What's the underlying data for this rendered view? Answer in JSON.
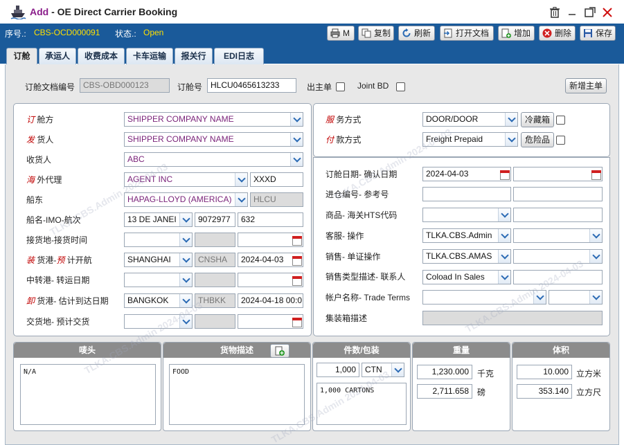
{
  "window": {
    "title_prefix": "Add",
    "title": " - OE Direct Carrier Booking"
  },
  "infobar": {
    "seq_label": "序号.:",
    "seq_value": "CBS-OCD000091",
    "status_label": "状态.:",
    "status_value": "Open"
  },
  "toolbar": {
    "m_label": "M",
    "copy_label": "复制",
    "refresh_label": "刷新",
    "open_doc_label": "打开文档",
    "add_label": "增加",
    "delete_label": "删除",
    "save_label": "保存"
  },
  "tabs": [
    {
      "label": "订舱"
    },
    {
      "label": "承运人"
    },
    {
      "label": "收费成本"
    },
    {
      "label": "卡车运输"
    },
    {
      "label": "报关行"
    },
    {
      "label": "EDI日志"
    }
  ],
  "top": {
    "doc_no_label": "订舱文档编号",
    "doc_no_value": "CBS-OBD000123",
    "booking_no_label": "订舱号",
    "booking_no_value": "HLCU0465613233",
    "master_bill_label": "出主单",
    "joint_bd_label": "Joint BD",
    "new_master_button": "新增主单"
  },
  "left": {
    "booker_label_red": "订",
    "booker_label": " 舱方",
    "booker_value": "SHIPPER COMPANY NAME",
    "shipper_label_red": "发",
    "shipper_label": " 货人",
    "shipper_value": "SHIPPER COMPANY NAME",
    "consignee_label": "收货人",
    "consignee_value": "ABC",
    "agent_label_red": "海",
    "agent_label": " 外代理",
    "agent_value": "AGENT INC",
    "agent_code": "XXXD",
    "carrier_label": "船东",
    "carrier_value": "HAPAG-LLOYD (AMERICA)",
    "carrier_code": "HLCU",
    "vessel_label": "船名-IMO-航次",
    "vessel_value": "13 DE JANEI",
    "imo_value": "9072977",
    "voyage_value": "632",
    "receipt_label": "接货地-接货时间",
    "receipt_value": "",
    "receipt_code": "",
    "receipt_date": "",
    "pol_label_red1": "装",
    "pol_label_mid": " 货港-",
    "pol_label_red2": "预",
    "pol_label_end": " 计开航",
    "pol_value": "SHANGHAI",
    "pol_code": "CNSHA",
    "pol_date": "2024-04-03",
    "transship_label": "中转港- 转运日期",
    "transship_value": "",
    "transship_code": "",
    "transship_date": "",
    "pod_label_red": "卸",
    "pod_label": " 货港- 估计到达日期",
    "pod_value": "BANGKOK",
    "pod_code": "THBKK",
    "pod_date": "2024-04-18 00:0",
    "delivery_label": "交货地- 预计交货",
    "delivery_value": "",
    "delivery_code": "",
    "delivery_date": ""
  },
  "right": {
    "service_label_red": "服",
    "service_label": " 务方式",
    "service_value": "DOOR/DOOR",
    "reefer_label": "冷藏箱",
    "payment_label_red": "付",
    "payment_label": " 款方式",
    "payment_value": "Freight Prepaid",
    "dg_label": "危险品",
    "booking_date_label": "订舱日期- 确认日期",
    "booking_date_value": "2024-04-03",
    "confirm_date_value": "",
    "entry_no_label": "进仓编号- 参考号",
    "entry_no_value": "",
    "ref_no_value": "",
    "commodity_label": "商品- 海关HTS代码",
    "commodity_value": "",
    "hts_value": "",
    "cs_label": "客服- 操作",
    "cs_value": "TLKA.CBS.Admin",
    "op_value": "",
    "sales_label": "销售- 单证操作",
    "sales_value": "TLKA.CBS.AMAS",
    "doc_op_value": "",
    "sales_type_label": "销售类型描述- 联系人",
    "sales_type_value": "Coload In Sales",
    "contact_value": "",
    "account_label": "帐户名称- Trade Terms",
    "account_value": "",
    "trade_terms_value": "",
    "container_desc_label": "集装箱描述",
    "container_desc_value": ""
  },
  "bottom": {
    "marks_header": "唛头",
    "marks_value": "N/A",
    "goods_header": "货物描述",
    "goods_value": "FOOD",
    "pkg_header": "件数/包装",
    "pkg_qty": "1,000",
    "pkg_unit": "CTN",
    "pkg_desc": "1,000 CARTONS",
    "weight_header": "重量",
    "weight_kg": "1,230.000",
    "weight_kg_unit": "千克",
    "weight_lb": "2,711.658",
    "weight_lb_unit": "磅",
    "volume_header": "体积",
    "volume_cbm": "10.000",
    "volume_cbm_unit": "立方米",
    "volume_cft": "353.140",
    "volume_cft_unit": "立方尺"
  },
  "watermark": "TLKA.CBS.Admin 2024-04-03",
  "colors": {
    "accent": "#1a5a9a",
    "status": "#ffe000",
    "required": "#c00000"
  }
}
